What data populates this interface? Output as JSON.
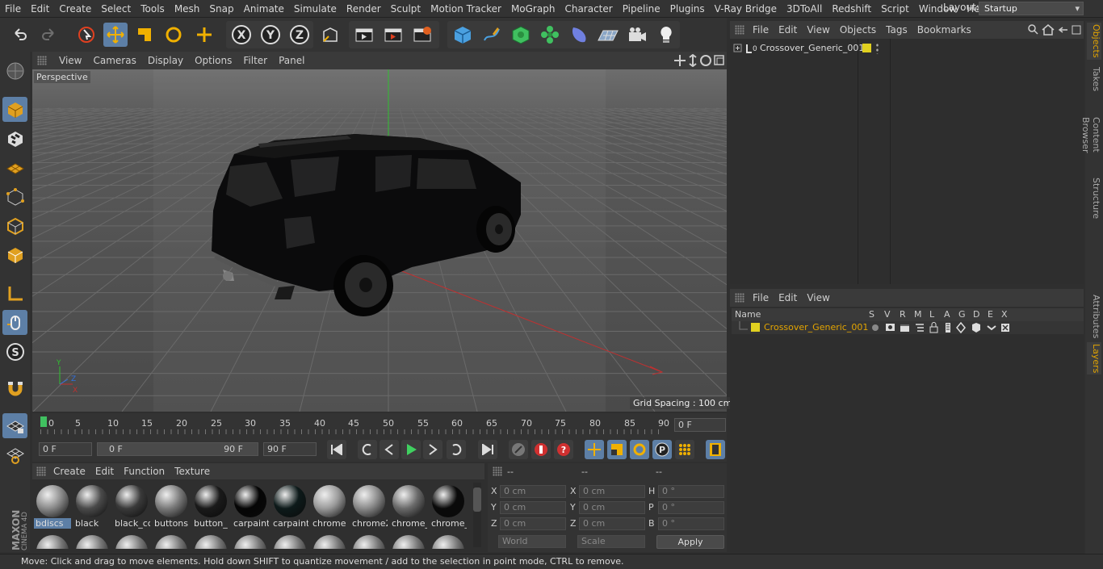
{
  "menubar": {
    "items": [
      "File",
      "Edit",
      "Create",
      "Select",
      "Tools",
      "Mesh",
      "Snap",
      "Animate",
      "Simulate",
      "Render",
      "Sculpt",
      "Motion Tracker",
      "MoGraph",
      "Character",
      "Pipeline",
      "Plugins",
      "V-Ray Bridge",
      "3DToAll",
      "Redshift",
      "Script",
      "Window",
      "Help"
    ],
    "layout_label": "Layout:",
    "layout_value": "Startup"
  },
  "viewport": {
    "menu": [
      "View",
      "Cameras",
      "Display",
      "Options",
      "Filter",
      "Panel"
    ],
    "label": "Perspective",
    "grid_spacing": "Grid Spacing : 100 cm"
  },
  "timeline": {
    "ticks": [
      "0",
      "5",
      "10",
      "15",
      "20",
      "25",
      "30",
      "35",
      "40",
      "45",
      "50",
      "55",
      "60",
      "65",
      "70",
      "75",
      "80",
      "85",
      "90"
    ],
    "current_frame": "0 F",
    "start_field": "0 F",
    "range_start": "0 F",
    "range_end": "90 F",
    "end_field": "90 F"
  },
  "materials": {
    "menu": [
      "Create",
      "Edit",
      "Function",
      "Texture"
    ],
    "items": [
      {
        "name": "bdiscs",
        "color": "#8a8a8a"
      },
      {
        "name": "black",
        "color": "#4a4a4a"
      },
      {
        "name": "black_cc",
        "color": "#3a3a3a"
      },
      {
        "name": "buttons",
        "color": "#7a7a7a"
      },
      {
        "name": "button_",
        "color": "#1a1a1a"
      },
      {
        "name": "carpaint",
        "color": "#050505"
      },
      {
        "name": "carpaint",
        "color": "#0d1a1a"
      },
      {
        "name": "chrome",
        "color": "#9a9a9a"
      },
      {
        "name": "chrome2",
        "color": "#8a8a8a"
      },
      {
        "name": "chrome_",
        "color": "#6a6a6a"
      },
      {
        "name": "chrome_",
        "color": "#0a0a0a"
      }
    ]
  },
  "coords": {
    "headers": [
      "--",
      "--",
      "--"
    ],
    "rows": [
      {
        "a": "X",
        "av": "0 cm",
        "b": "X",
        "bv": "0 cm",
        "c": "H",
        "cv": "0 °"
      },
      {
        "a": "Y",
        "av": "0 cm",
        "b": "Y",
        "bv": "0 cm",
        "c": "P",
        "cv": "0 °"
      },
      {
        "a": "Z",
        "av": "0 cm",
        "b": "Z",
        "bv": "0 cm",
        "c": "B",
        "cv": "0 °"
      }
    ],
    "world": "World",
    "scale": "Scale",
    "apply": "Apply"
  },
  "objects": {
    "menu": [
      "File",
      "Edit",
      "View",
      "Objects",
      "Tags",
      "Bookmarks"
    ],
    "item": "Crossover_Generic_001"
  },
  "layers": {
    "menu": [
      "File",
      "Edit",
      "View"
    ],
    "columns": [
      "Name",
      "S",
      "V",
      "R",
      "M",
      "L",
      "A",
      "G",
      "D",
      "E",
      "X"
    ],
    "item": "Crossover_Generic_001"
  },
  "right_tabs": [
    "Objects",
    "Takes",
    "Content Browser",
    "Structure",
    "Attributes",
    "Layers"
  ],
  "status": "Move: Click and drag to move elements. Hold down SHIFT to quantize movement / add to the selection in point mode, CTRL to remove.",
  "brand": {
    "line1": "MAXON",
    "line2": "CINEMA 4D"
  },
  "colors": {
    "accent": "#5d7fa6",
    "layer_yellow": "#e0d020",
    "highlight_orange": "#e3a400"
  }
}
